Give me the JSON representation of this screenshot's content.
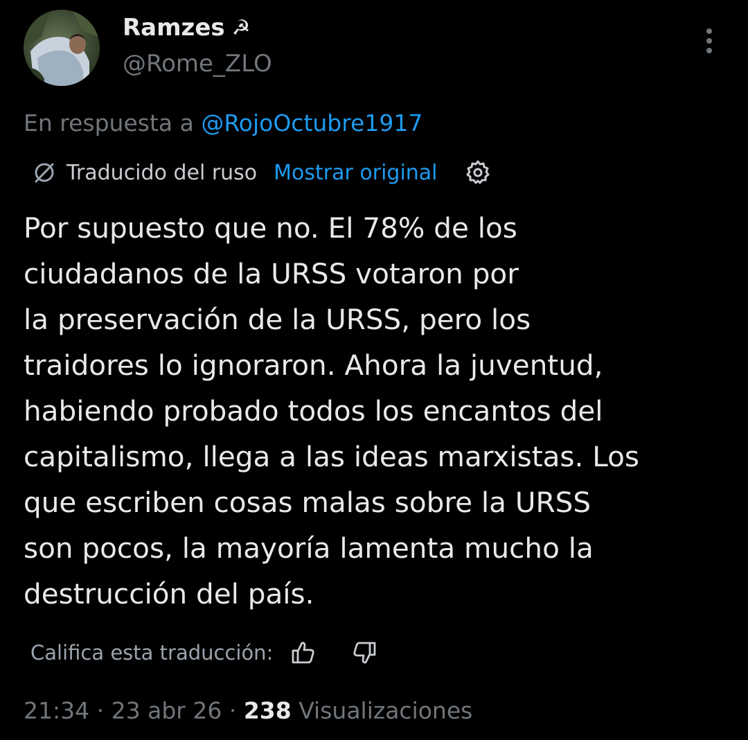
{
  "author": {
    "display_name": "Ramzes",
    "name_emoji": "☭",
    "handle": "@Rome_ZLO",
    "avatar_icon": "profile-photo"
  },
  "reply": {
    "prefix": "En respuesta a",
    "mention": "@RojoOctubre1917"
  },
  "translation": {
    "icon": "globe-icon",
    "label": "Traducido del ruso",
    "show_original": "Mostrar original",
    "settings_icon": "gear-icon"
  },
  "tweet": {
    "lines": [
      "Por supuesto que no. El 78% de los",
      "ciudadanos de la URSS votaron por",
      "la preservación de la URSS, pero los",
      "traidores lo ignoraron. Ahora la juventud,",
      "habiendo probado todos los encantos del",
      "capitalismo, llega a las ideas marxistas. Los",
      "que escriben cosas malas sobre la URSS",
      "son pocos, la mayoría lamenta mucho la",
      "destrucción del país."
    ]
  },
  "rating": {
    "label": "Califica esta traducción:",
    "up_icon": "thumbs-up-icon",
    "down_icon": "thumbs-down-icon"
  },
  "meta": {
    "time": "21:34",
    "separator": "·",
    "date": "23 abr 26",
    "views_count": "238",
    "views_label": "Visualizaciones"
  },
  "colors": {
    "background": "#000000",
    "primary_text": "#e7e9ea",
    "secondary_text": "#71767b",
    "link": "#1d9bf0"
  }
}
